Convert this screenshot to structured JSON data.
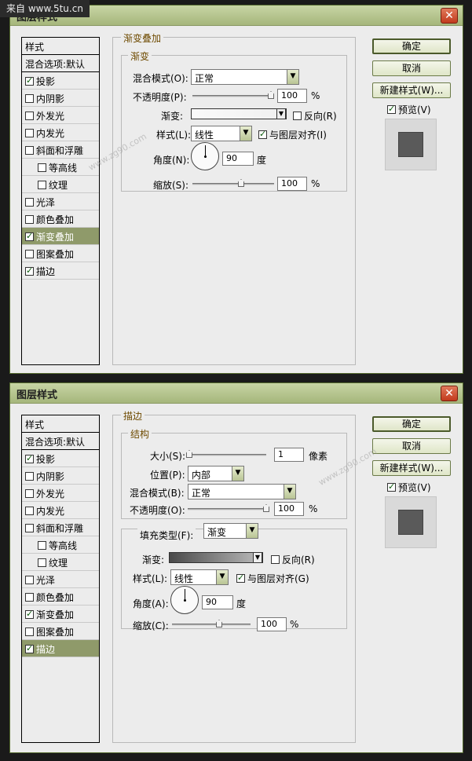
{
  "watermark_top": "来自 www.5tu.cn",
  "watermarks": [
    "www.zg90.com",
    "www.zg90.com"
  ],
  "colors": {
    "titlebar": "#b4c38c",
    "active_item": "#8f9a6a",
    "legend_text": "#6e4a00"
  },
  "dialog1": {
    "title": "图层样式",
    "close_icon": "close-icon",
    "sidebar": {
      "header": "样式",
      "blend": "混合选项:默认",
      "items": [
        {
          "label": "投影",
          "checked": true
        },
        {
          "label": "内阴影",
          "checked": false
        },
        {
          "label": "外发光",
          "checked": false
        },
        {
          "label": "内发光",
          "checked": false
        },
        {
          "label": "斜面和浮雕",
          "checked": false
        },
        {
          "label": "等高线",
          "checked": false
        },
        {
          "label": "纹理",
          "checked": false
        },
        {
          "label": "光泽",
          "checked": false
        },
        {
          "label": "颜色叠加",
          "checked": false
        },
        {
          "label": "渐变叠加",
          "checked": true
        },
        {
          "label": "图案叠加",
          "checked": false
        },
        {
          "label": "描边",
          "checked": true
        }
      ]
    },
    "panel": {
      "legend": "渐变叠加",
      "group_legend": "渐变",
      "blend_mode_label": "混合模式(O):",
      "blend_mode_value": "正常",
      "opacity_label": "不透明度(P):",
      "opacity_value": "100",
      "opacity_unit": "%",
      "gradient_label": "渐变:",
      "reverse_label": "反向(R)",
      "style_label": "样式(L):",
      "style_value": "线性",
      "align_label": "与图层对齐(I)",
      "angle_label": "角度(N):",
      "angle_value": "90",
      "angle_unit": "度",
      "scale_label": "缩放(S):",
      "scale_value": "100",
      "scale_unit": "%"
    },
    "buttons": {
      "ok": "确定",
      "cancel": "取消",
      "new_style": "新建样式(W)...",
      "preview": "预览(V)"
    }
  },
  "dialog2": {
    "title": "图层样式",
    "sidebar": {
      "header": "样式",
      "blend": "混合选项:默认",
      "items": [
        {
          "label": "投影",
          "checked": true
        },
        {
          "label": "内阴影",
          "checked": false
        },
        {
          "label": "外发光",
          "checked": false
        },
        {
          "label": "内发光",
          "checked": false
        },
        {
          "label": "斜面和浮雕",
          "checked": false
        },
        {
          "label": "等高线",
          "checked": false
        },
        {
          "label": "纹理",
          "checked": false
        },
        {
          "label": "光泽",
          "checked": false
        },
        {
          "label": "颜色叠加",
          "checked": false
        },
        {
          "label": "渐变叠加",
          "checked": true
        },
        {
          "label": "图案叠加",
          "checked": false
        },
        {
          "label": "描边",
          "checked": true
        }
      ]
    },
    "panel": {
      "legend": "描边",
      "group_legend": "结构",
      "size_label": "大小(S):",
      "size_value": "1",
      "size_unit": "像素",
      "position_label": "位置(P):",
      "position_value": "内部",
      "blend_mode_label": "混合模式(B):",
      "blend_mode_value": "正常",
      "opacity_label": "不透明度(O):",
      "opacity_value": "100",
      "opacity_unit": "%",
      "fill_type_label": "填充类型(F):",
      "fill_type_value": "渐变",
      "gradient_label": "渐变:",
      "reverse_label": "反向(R)",
      "style_label": "样式(L):",
      "style_value": "线性",
      "align_label": "与图层对齐(G)",
      "angle_label": "角度(A):",
      "angle_value": "90",
      "angle_unit": "度",
      "scale_label": "缩放(C):",
      "scale_value": "100",
      "scale_unit": "%"
    },
    "buttons": {
      "ok": "确定",
      "cancel": "取消",
      "new_style": "新建样式(W)...",
      "preview": "预览(V)"
    }
  }
}
